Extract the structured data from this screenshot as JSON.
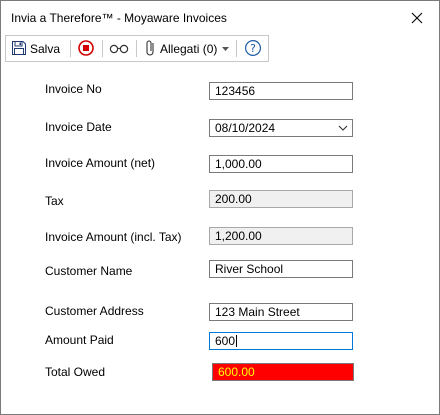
{
  "window": {
    "title": "Invia a Therefore™ - Moyaware Invoices"
  },
  "toolbar": {
    "save_label": "Salva",
    "attachments_label": "Allegati (0)"
  },
  "form": {
    "invoice_no": {
      "label": "Invoice No",
      "value": "123456"
    },
    "invoice_date": {
      "label": "Invoice Date",
      "value": "08/10/2024"
    },
    "invoice_amount_net": {
      "label": "Invoice Amount (net)",
      "value": "1,000.00"
    },
    "tax": {
      "label": "Tax",
      "value": "200.00"
    },
    "invoice_amount_incl": {
      "label": "Invoice Amount (incl. Tax)",
      "value": "1,200.00"
    },
    "customer_name": {
      "label": "Customer Name",
      "value": "River School"
    },
    "customer_address": {
      "label": "Customer Address",
      "value": "123 Main Street"
    },
    "amount_paid": {
      "label": "Amount Paid",
      "value": "600"
    },
    "total_owed": {
      "label": "Total Owed",
      "value": "600.00"
    }
  },
  "colors": {
    "total_owed_background": "#ff0000",
    "total_owed_text": "#ffff00",
    "focus_border": "#0078d7",
    "readonly_background": "#f0f0f0"
  },
  "icons": {
    "save": "floppy-disk-icon",
    "stop": "stop-icon",
    "view": "glasses-icon",
    "attach": "paperclip-icon",
    "help": "help-icon",
    "close": "close-icon"
  }
}
